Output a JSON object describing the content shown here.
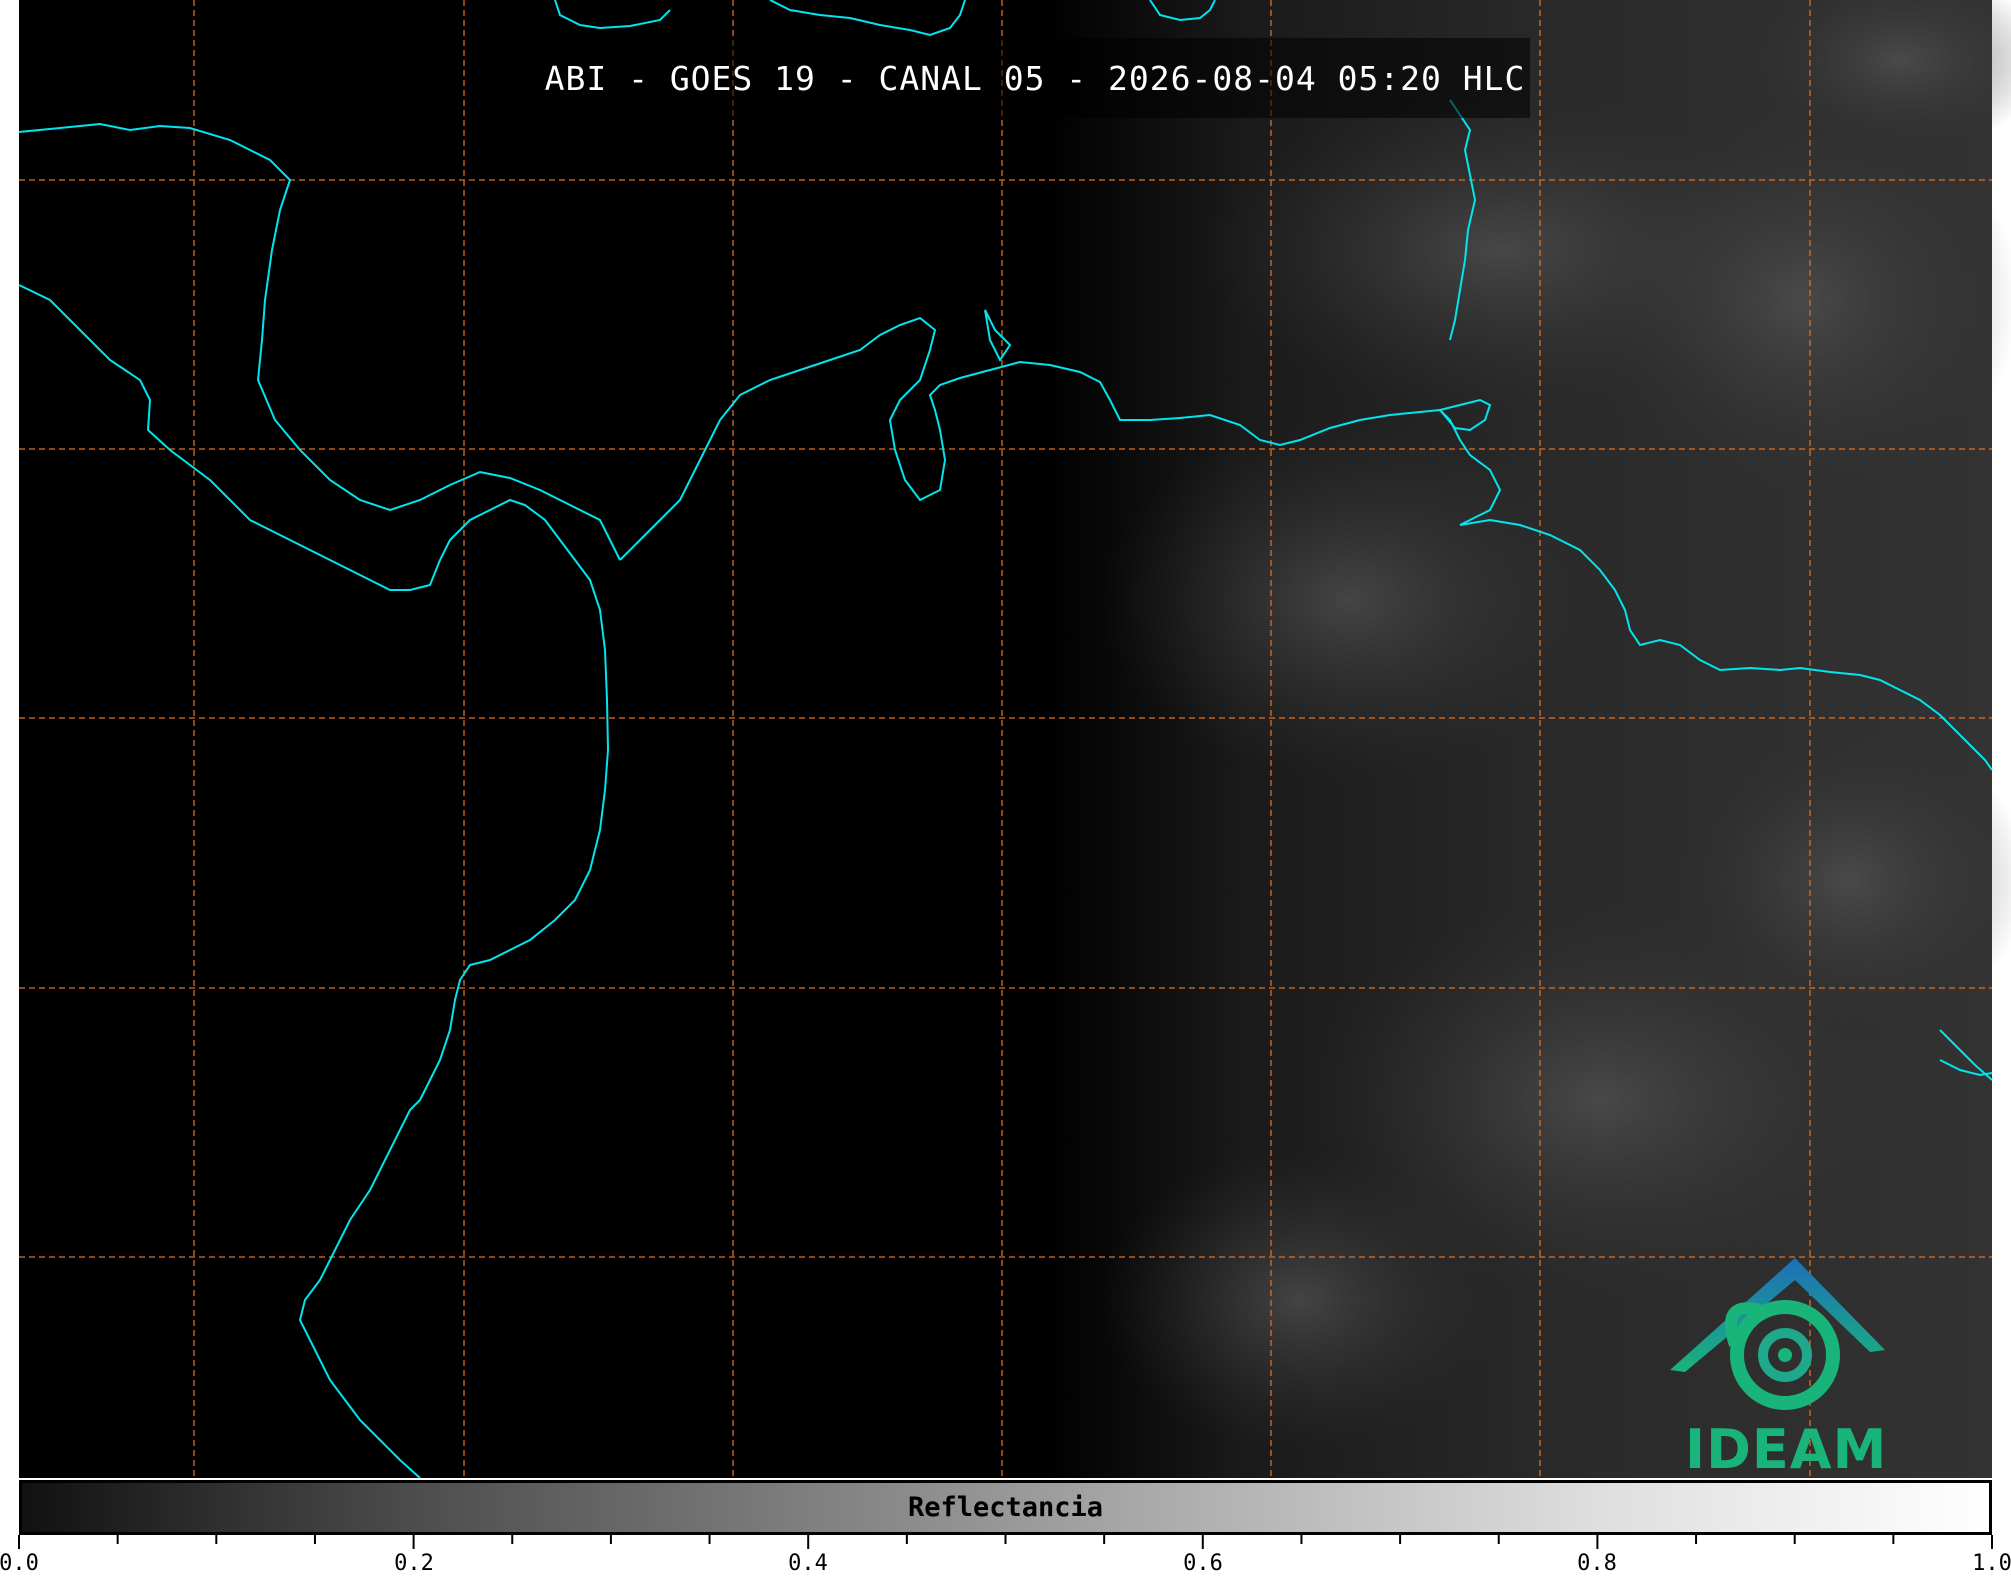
{
  "title": "ABI - GOES 19 - CANAL 05 - 2026-08-04 05:20 HLC",
  "colorbar": {
    "label": "Reflectancia",
    "ticks": [
      "0.0",
      "0.2",
      "0.4",
      "0.6",
      "0.8",
      "1.0"
    ],
    "range": [
      0.0,
      1.0
    ],
    "colormap": "grayscale"
  },
  "logo": {
    "text": "IDEAM"
  },
  "colors": {
    "coastline": "#00e5ee",
    "gridlines": "#e07020",
    "logo_blue": "#1e6fb8",
    "logo_green": "#19b47a"
  }
}
